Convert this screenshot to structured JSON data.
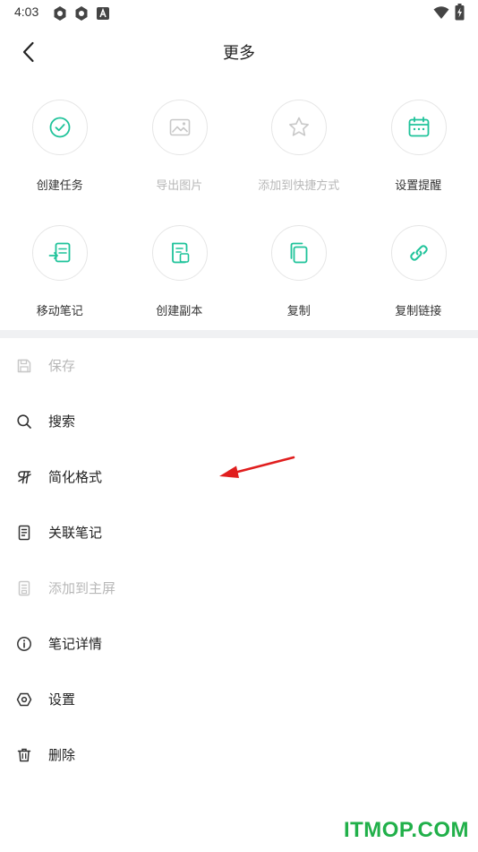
{
  "status_bar": {
    "time": "4:03",
    "icons": [
      "settings-sync-icon",
      "settings-sync-icon",
      "font-a-icon",
      "wifi-icon",
      "battery-charging-icon"
    ]
  },
  "header": {
    "title": "更多",
    "back_icon": "chevron-left-icon"
  },
  "grid": [
    {
      "label": "创建任务",
      "icon": "check-circle-icon",
      "enabled": true
    },
    {
      "label": "导出图片",
      "icon": "image-icon",
      "enabled": false
    },
    {
      "label": "添加到快捷方式",
      "icon": "star-icon",
      "enabled": false
    },
    {
      "label": "设置提醒",
      "icon": "calendar-icon",
      "enabled": true
    },
    {
      "label": "移动笔记",
      "icon": "move-note-icon",
      "enabled": true
    },
    {
      "label": "创建副本",
      "icon": "copy-note-icon",
      "enabled": true
    },
    {
      "label": "复制",
      "icon": "copy-icon",
      "enabled": true
    },
    {
      "label": "复制链接",
      "icon": "link-icon",
      "enabled": true
    }
  ],
  "menu": [
    {
      "label": "保存",
      "icon": "save-icon",
      "enabled": false
    },
    {
      "label": "搜索",
      "icon": "search-icon",
      "enabled": true
    },
    {
      "label": "简化格式",
      "icon": "paragraph-icon",
      "enabled": true
    },
    {
      "label": "关联笔记",
      "icon": "document-icon",
      "enabled": true
    },
    {
      "label": "添加到主屏",
      "icon": "home-screen-icon",
      "enabled": false
    },
    {
      "label": "笔记详情",
      "icon": "info-icon",
      "enabled": true
    },
    {
      "label": "设置",
      "icon": "settings-icon",
      "enabled": true
    },
    {
      "label": "删除",
      "icon": "trash-icon",
      "enabled": true
    }
  ],
  "colors": {
    "accent": "#1fc39a",
    "disabled": "#c8c8c8",
    "arrow": "#e01e1e",
    "watermark": "#21b04a"
  },
  "watermark": "ITMOP.COM"
}
